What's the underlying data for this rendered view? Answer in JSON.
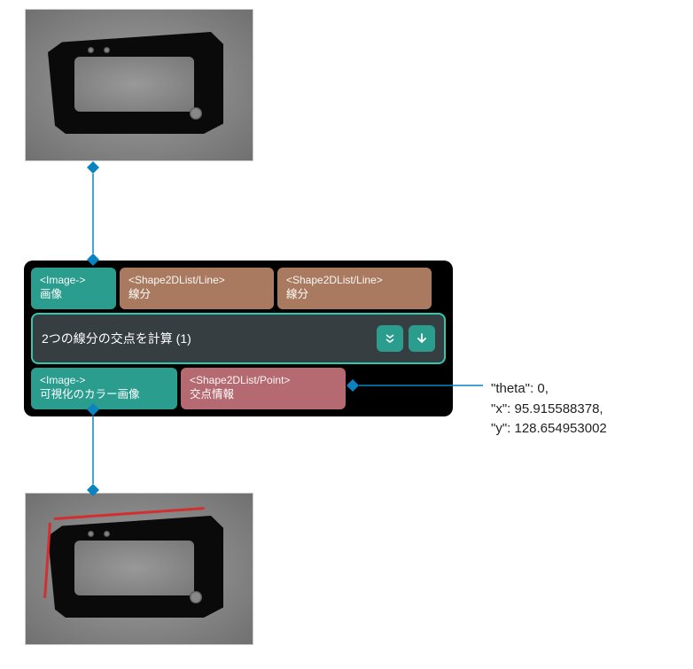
{
  "node": {
    "inputs": [
      {
        "type": "<Image->",
        "label": "画像",
        "color": "teal"
      },
      {
        "type": "<Shape2DList/Line>",
        "label": "線分",
        "color": "brown"
      },
      {
        "type": "<Shape2DList/Line>",
        "label": "線分",
        "color": "brown"
      }
    ],
    "title": "2つの線分の交点を計算 (1)",
    "outputs": [
      {
        "type": "<Image->",
        "label": "可視化のカラー画像",
        "color": "teal"
      },
      {
        "type": "<Shape2DList/Point>",
        "label": "交点情報",
        "color": "rose"
      }
    ]
  },
  "output_values": {
    "line1": "\"theta\": 0,",
    "line2": "\"x\": 95.915588378,",
    "line3": "\"y\": 128.654953002"
  }
}
